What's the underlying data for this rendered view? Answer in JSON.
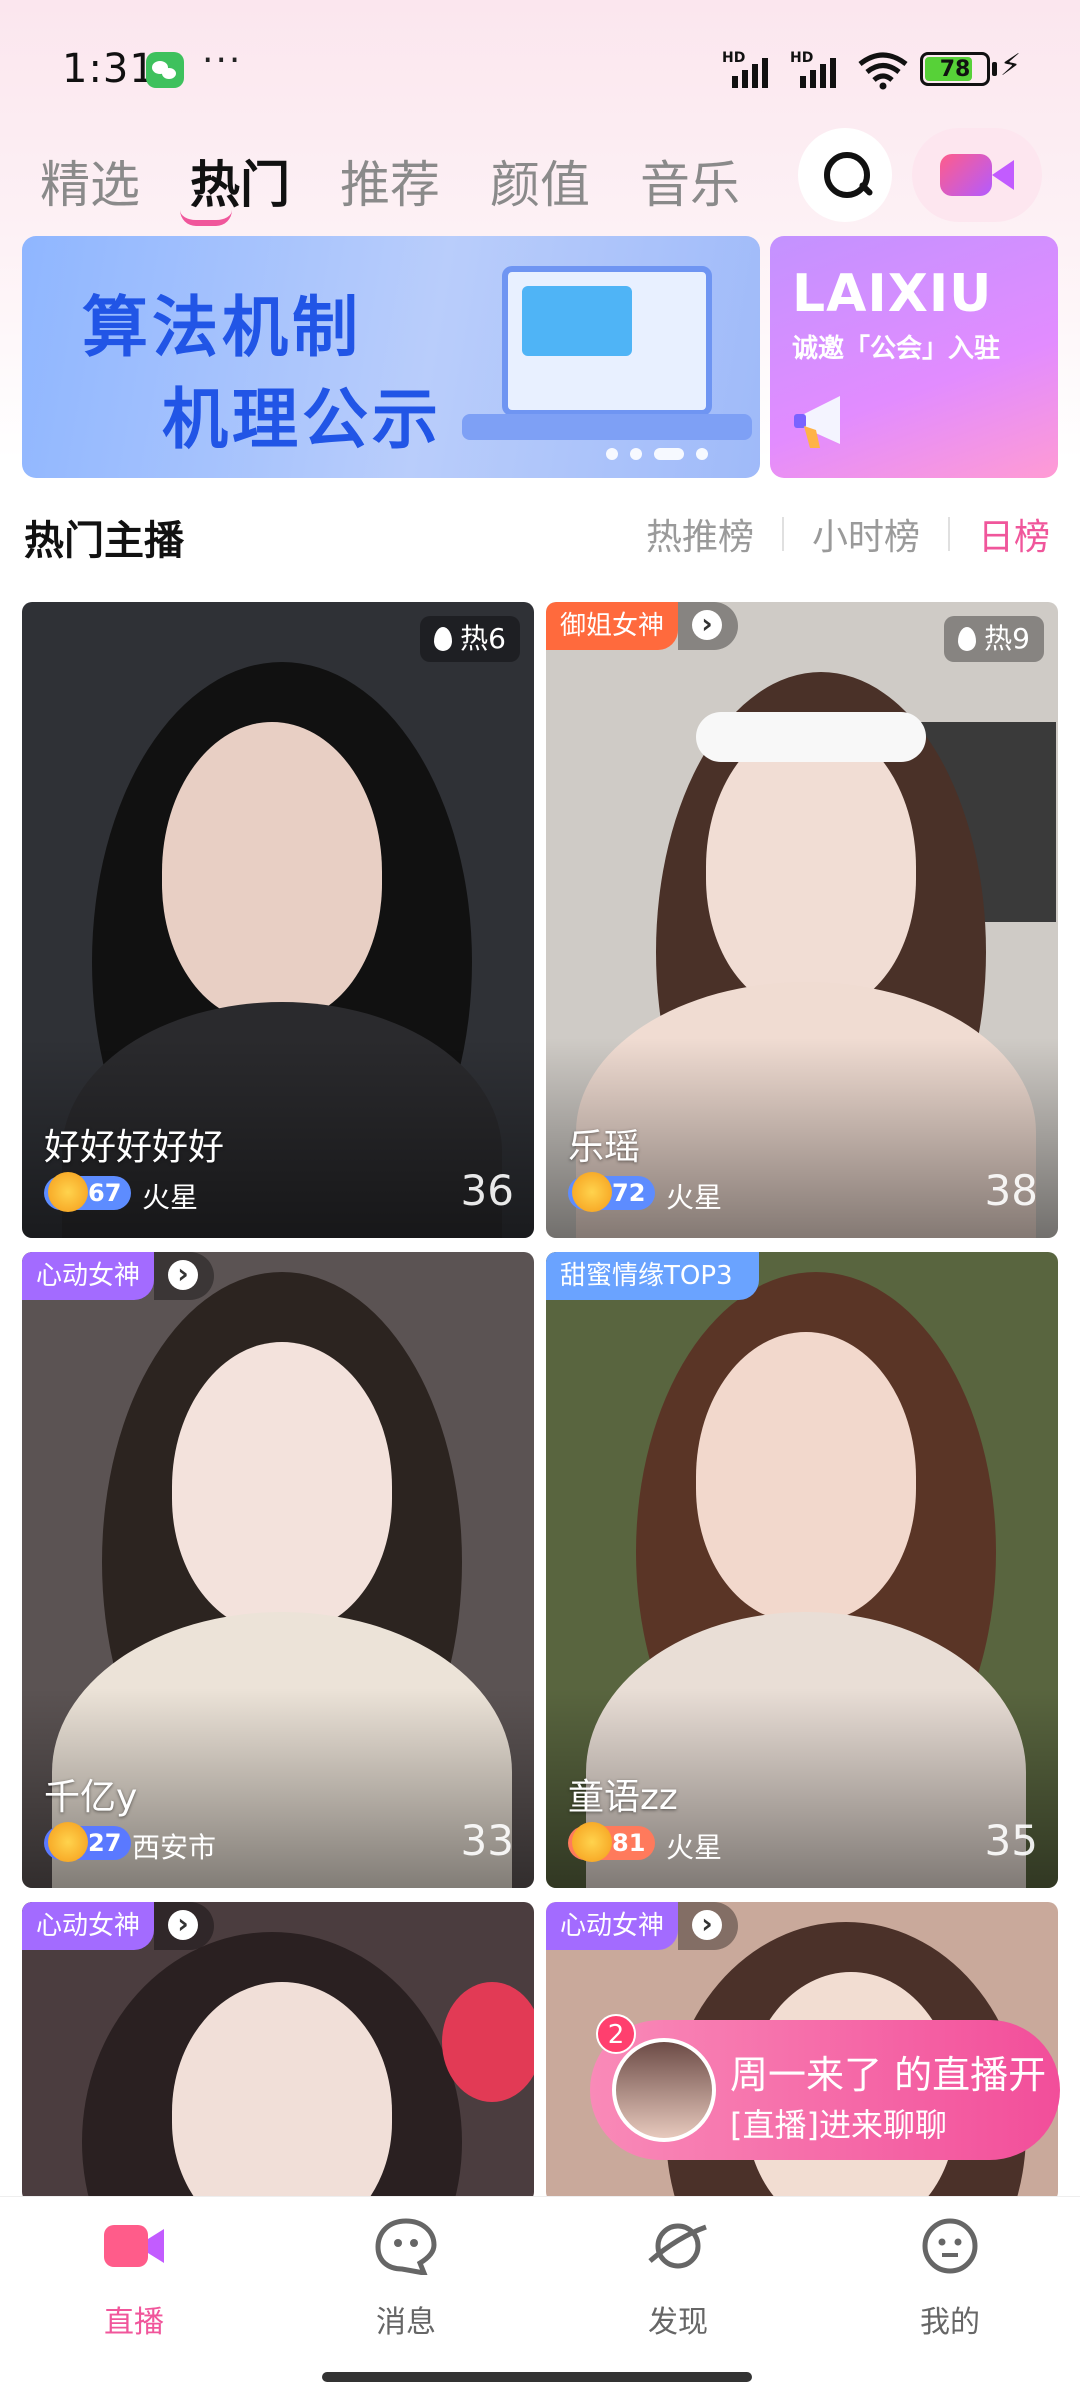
{
  "status_bar": {
    "time": "1:31",
    "more": "···",
    "signal_label": "HD",
    "battery": "78",
    "battery_level": 0.78
  },
  "top_tabs": [
    {
      "label": "精选",
      "active": false
    },
    {
      "label": "热门",
      "active": true
    },
    {
      "label": "推荐",
      "active": false
    },
    {
      "label": "颜值",
      "active": false
    },
    {
      "label": "音乐",
      "active": false
    }
  ],
  "banner": {
    "main_line1": "算法机制",
    "main_line2": "机理公示",
    "side_title": "LAIXIU",
    "side_subtitle": "诚邀「公会」入驻"
  },
  "section": {
    "title": "热门主播",
    "rank_tabs": [
      "热推榜",
      "小时榜",
      "日榜"
    ],
    "active_rank": "日榜"
  },
  "cards": [
    {
      "name": "好好好好好",
      "level": "67",
      "location": "火星",
      "viewers": "36",
      "heat": "热6",
      "tag": ""
    },
    {
      "name": "乐瑶",
      "level": "72",
      "location": "火星",
      "viewers": "38",
      "heat": "热9",
      "tag": "御姐女神"
    },
    {
      "name": "千亿y",
      "level": "27",
      "location": "西安市",
      "viewers": "33",
      "heat": "",
      "tag": "心动女神"
    },
    {
      "name": "童语zz",
      "level": "81",
      "location": "火星",
      "viewers": "35",
      "heat": "",
      "tag": "甜蜜情缘TOP3"
    },
    {
      "name": "",
      "level": "",
      "location": "",
      "viewers": "",
      "heat": "",
      "tag": "心动女神"
    },
    {
      "name": "",
      "level": "",
      "location": "",
      "viewers": "",
      "heat": "",
      "tag": "心动女神"
    }
  ],
  "notification": {
    "count": "2",
    "title": "周一来了 的直播开",
    "subtitle": "[直播]进来聊聊"
  },
  "bottom_nav": [
    {
      "label": "直播",
      "icon": "live-camera-icon",
      "active": true
    },
    {
      "label": "消息",
      "icon": "message-bubble-icon",
      "active": false
    },
    {
      "label": "发现",
      "icon": "planet-icon",
      "active": false
    },
    {
      "label": "我的",
      "icon": "profile-face-icon",
      "active": false
    }
  ],
  "colors": {
    "accent": "#f0569b",
    "banner_blue": "#2155e6",
    "tag_orange": "#ff6a3d",
    "tag_purple": "#a36bff",
    "tag_blue": "#6aa3ff"
  }
}
